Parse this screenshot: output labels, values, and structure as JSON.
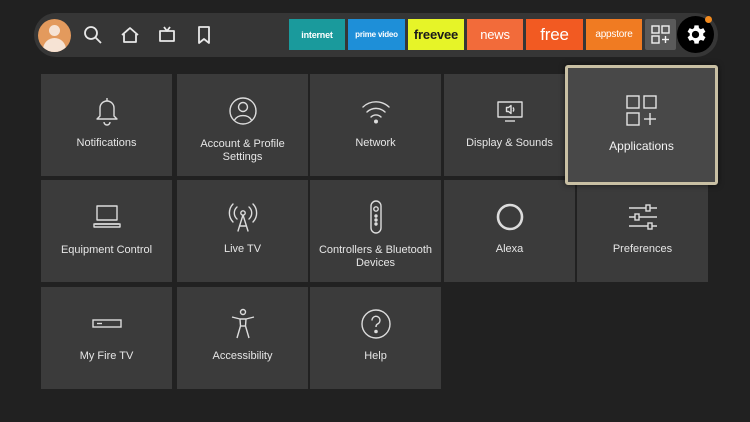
{
  "nav": {
    "profile": "profile-avatar",
    "icons": [
      "search-icon",
      "home-icon",
      "live-tv-icon",
      "bookmark-icon"
    ],
    "apps": [
      {
        "id": "internet",
        "label": "internet"
      },
      {
        "id": "prime",
        "label": "prime video"
      },
      {
        "id": "freevee",
        "label": "freevee"
      },
      {
        "id": "news",
        "label": "news"
      },
      {
        "id": "free",
        "label": "free"
      },
      {
        "id": "appstore",
        "label": "appstore"
      }
    ],
    "colors": {
      "internet": "#1a9a9c",
      "prime": "#1e8fd8",
      "freevee": "#e6f428",
      "news": "#f26b3a",
      "free": "#f25a22",
      "appstore": "#f07b22",
      "notification_dot": "#f28a1e"
    }
  },
  "settings": {
    "focused": "Applications",
    "tiles": [
      {
        "label": "Notifications",
        "icon": "bell-icon"
      },
      {
        "label": "Account & Profile Settings",
        "icon": "user-icon"
      },
      {
        "label": "Network",
        "icon": "wifi-icon"
      },
      {
        "label": "Display & Sounds",
        "icon": "display-icon"
      },
      {
        "label": "Applications",
        "icon": "apps-icon"
      },
      {
        "label": "Equipment Control",
        "icon": "monitor-icon"
      },
      {
        "label": "Live TV",
        "icon": "antenna-icon"
      },
      {
        "label": "Controllers & Bluetooth Devices",
        "icon": "remote-icon"
      },
      {
        "label": "Alexa",
        "icon": "alexa-icon"
      },
      {
        "label": "Preferences",
        "icon": "sliders-icon"
      },
      {
        "label": "My Fire TV",
        "icon": "fire-tv-device-icon"
      },
      {
        "label": "Accessibility",
        "icon": "accessibility-icon"
      },
      {
        "label": "Help",
        "icon": "help-icon"
      }
    ]
  }
}
